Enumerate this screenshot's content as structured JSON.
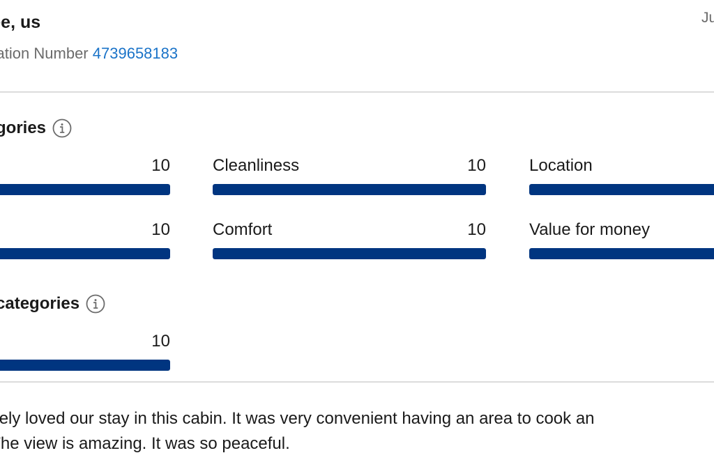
{
  "guest": {
    "name": "nee, us",
    "reservation_label": "ervation Number",
    "reservation_number": "4739658183",
    "date_fragment": "Ju"
  },
  "categories": {
    "title": "gories",
    "items": [
      {
        "label": "",
        "value": "10",
        "score": 10
      },
      {
        "label": "Cleanliness",
        "value": "10",
        "score": 10
      },
      {
        "label": "Location",
        "value": "",
        "score": 10
      },
      {
        "label": "",
        "value": "10",
        "score": 10
      },
      {
        "label": "Comfort",
        "value": "10",
        "score": 10
      },
      {
        "label": "Value for money",
        "value": "",
        "score": 10
      }
    ]
  },
  "sub_categories": {
    "title": "categories",
    "items": [
      {
        "label": "",
        "value": "10",
        "score": 10
      }
    ]
  },
  "review": {
    "line1": "olutely loved our stay in this cabin. It was very convenient having an area to cook an",
    "line2": "e. The view is amazing. It was so peaceful."
  },
  "colors": {
    "bar_fill": "#003580",
    "link": "#1a73c8",
    "muted_text": "#6b6b6b"
  },
  "max_score": 10
}
